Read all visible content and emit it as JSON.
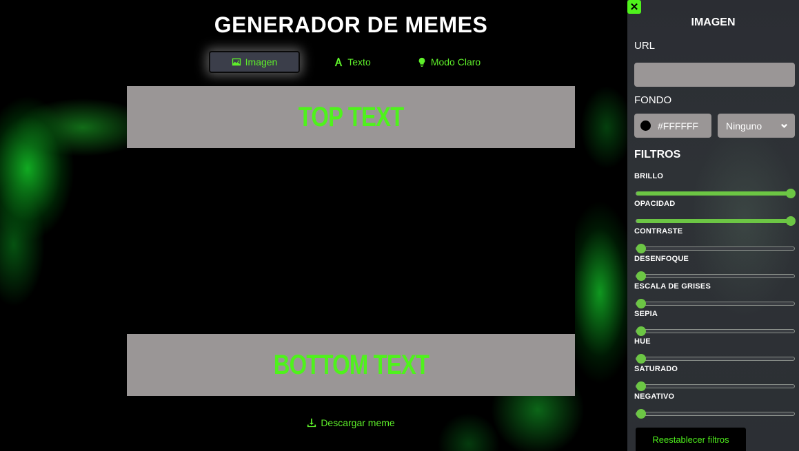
{
  "header": {
    "title": "GENERADOR DE MEMES"
  },
  "nav": {
    "image_label": "Imagen",
    "text_label": "Texto",
    "mode_label": "Modo Claro"
  },
  "meme": {
    "top_text": "TOP TEXT",
    "bottom_text": "BOTTOM TEXT",
    "text_color": "#4ff21c",
    "text_bg_color": "#9a9696"
  },
  "download": {
    "label": "Descargar meme"
  },
  "panel": {
    "close_label": "✕",
    "title": "IMAGEN",
    "url_label": "URL",
    "url_value": "",
    "background_label": "FONDO",
    "background_color": "#FFFFFF",
    "blend_mode": "Ninguno",
    "filters_title": "FILTROS",
    "filters": [
      {
        "label": "BRILLO",
        "value": 1.0
      },
      {
        "label": "OPACIDAD",
        "value": 1.0
      },
      {
        "label": "CONTRASTE",
        "value": 0
      },
      {
        "label": "DESENFOQUE",
        "value": 0
      },
      {
        "label": "ESCALA DE GRISES",
        "value": 0
      },
      {
        "label": "SEPIA",
        "value": 0
      },
      {
        "label": "HUE",
        "value": 0
      },
      {
        "label": "SATURADO",
        "value": 0
      },
      {
        "label": "NEGATIVO",
        "value": 0
      }
    ],
    "reset_label": "Reestablecer filtros"
  },
  "colors": {
    "accent": "#4ff21c",
    "slider": "#6cc644",
    "panel_bg": "#2c2f34"
  }
}
